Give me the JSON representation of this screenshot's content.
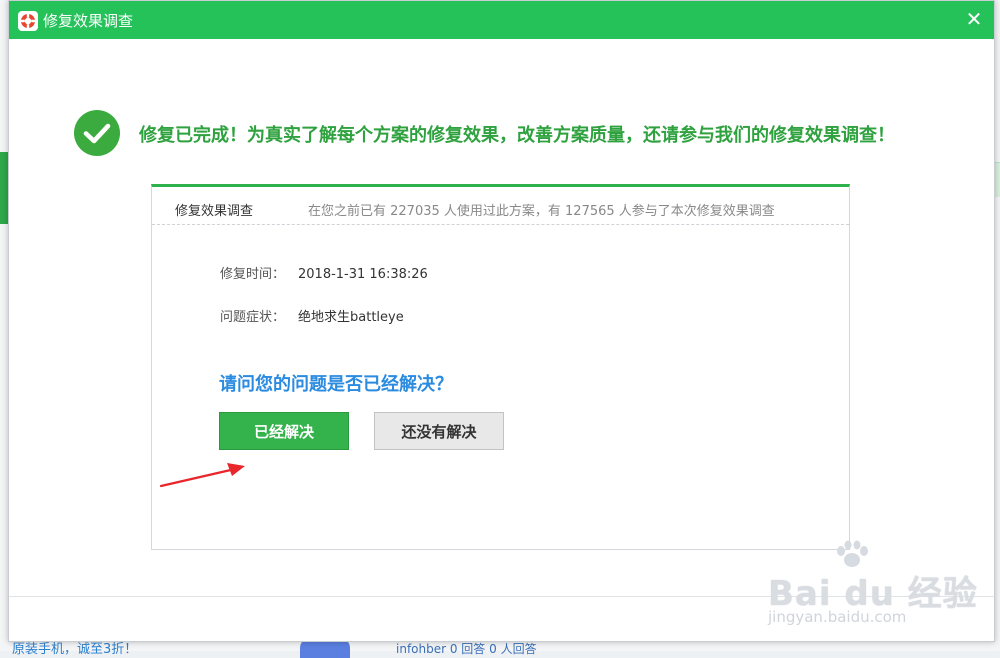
{
  "window": {
    "title": "修复效果调查",
    "close_icon": "✕"
  },
  "success": {
    "message": "修复已完成！为真实了解每个方案的修复效果，改善方案质量，还请参与我们的修复效果调查！"
  },
  "survey": {
    "title": "修复效果调查",
    "stats": "在您之前已有 227035 人使用过此方案，有 127565 人参与了本次修复效果调查",
    "fields": [
      {
        "label": "修复时间：",
        "value": "2018-1-31 16:38:26"
      },
      {
        "label": "问题症状：",
        "value": "绝地求生battleye"
      }
    ],
    "question": "请问您的问题是否已经解决？",
    "yes_label": "已经解决",
    "no_label": "还没有解决"
  },
  "background": {
    "bottom_text": "原装手机，诚至3折！",
    "bottom_links": "infohber 0 回答  0 人回答"
  },
  "watermark": {
    "brand": "Bai du 经验",
    "url": "jingyan.baidu.com"
  },
  "colors": {
    "titlebar": "#25c25a",
    "success_green": "#2fa23f",
    "question_blue": "#2a8be0",
    "yes_button": "#34b24b",
    "arrow_red": "#e8262b"
  }
}
